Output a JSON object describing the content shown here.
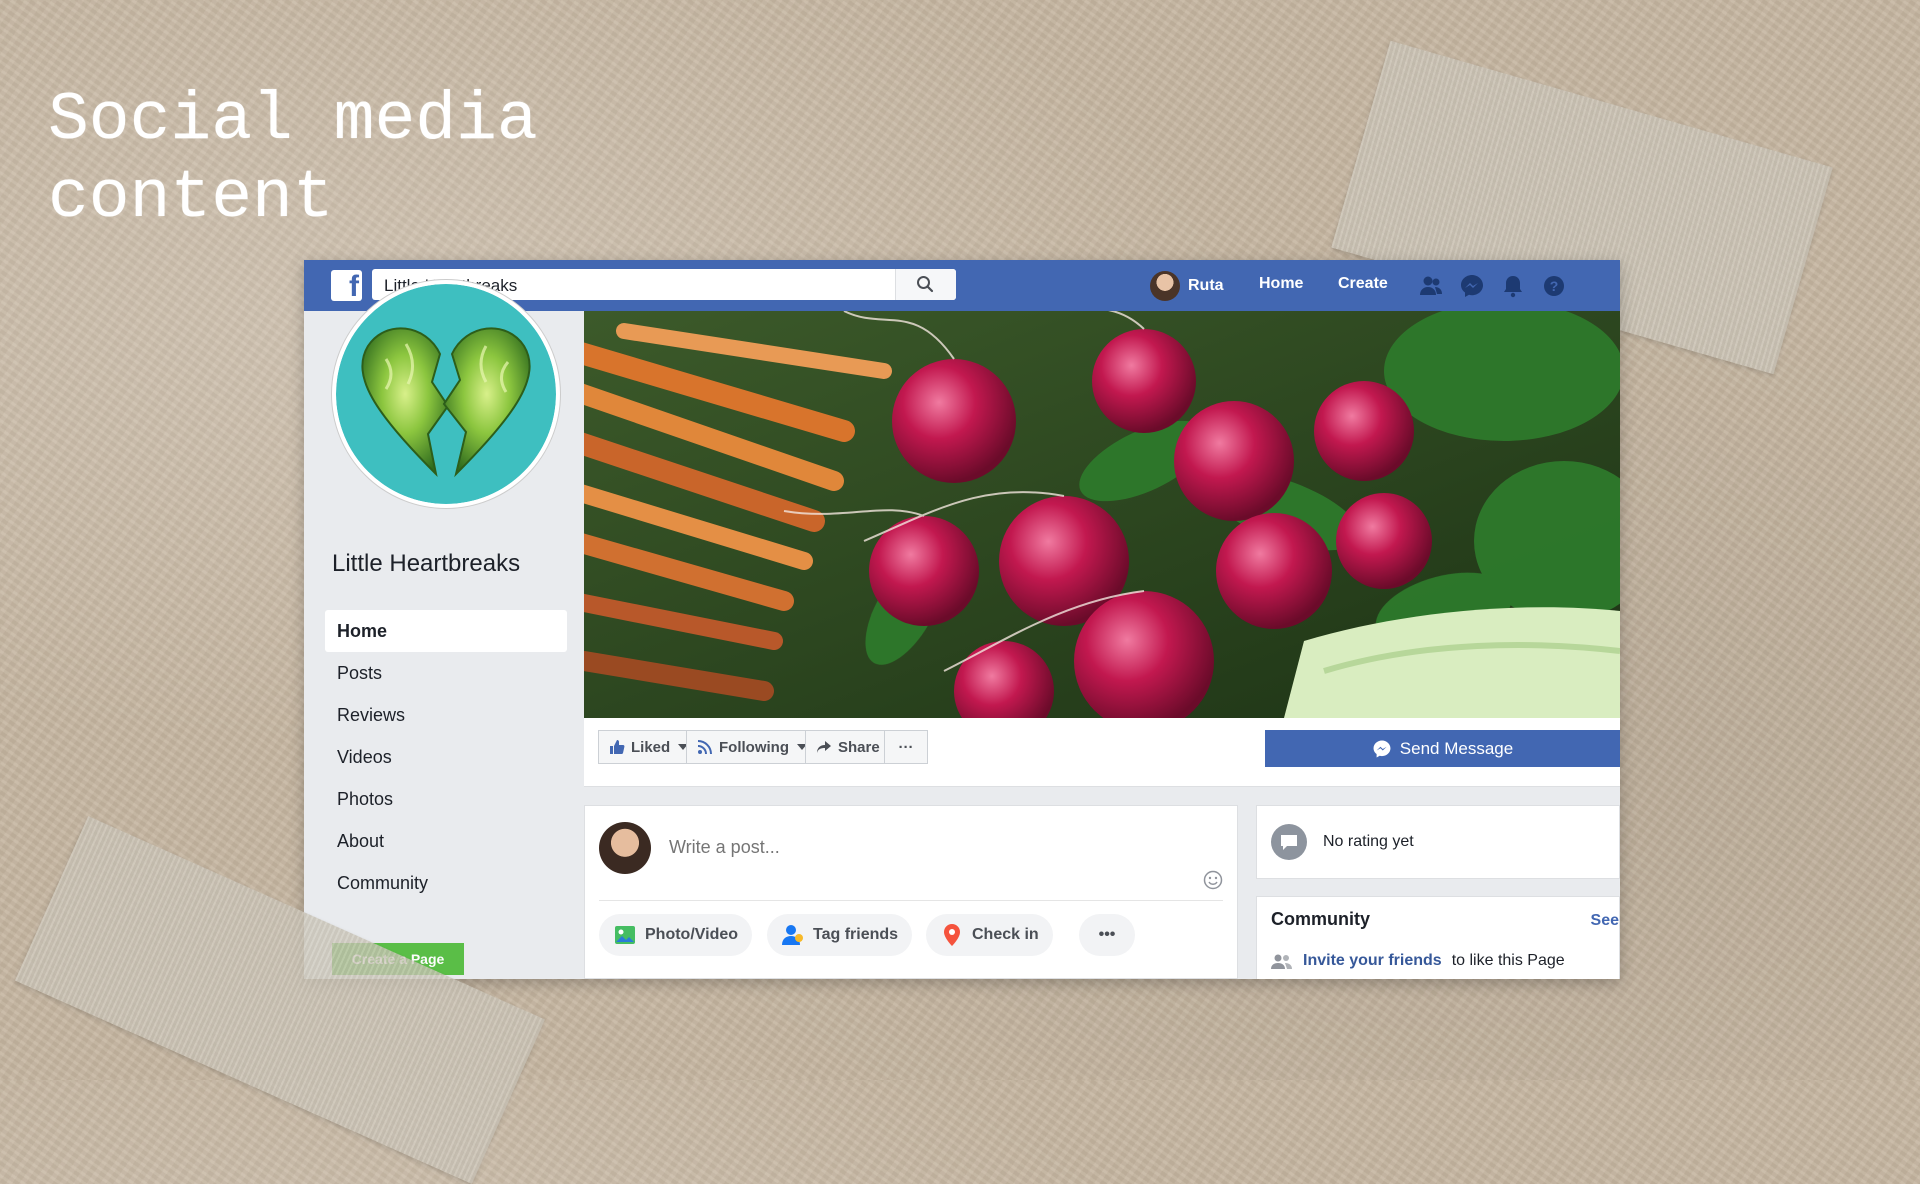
{
  "slide": {
    "title": "Social media\ncontent"
  },
  "topbar": {
    "search_value": "Little Heartbreaks",
    "user_name": "Ruta",
    "nav_home": "Home",
    "nav_create": "Create"
  },
  "page": {
    "name": "Little Heartbreaks"
  },
  "sidebar": {
    "items": [
      {
        "label": "Home",
        "active": true
      },
      {
        "label": "Posts"
      },
      {
        "label": "Reviews"
      },
      {
        "label": "Videos"
      },
      {
        "label": "Photos"
      },
      {
        "label": "About"
      },
      {
        "label": "Community"
      }
    ],
    "create_page": "Create a Page"
  },
  "actions": {
    "liked": "Liked",
    "following": "Following",
    "share": "Share",
    "more": "···",
    "send_message": "Send Message"
  },
  "composer": {
    "placeholder": "Write a post...",
    "photo_video": "Photo/Video",
    "tag_friends": "Tag friends",
    "check_in": "Check in",
    "more": "•••"
  },
  "rating": {
    "text": "No rating yet"
  },
  "community": {
    "title": "Community",
    "see_all": "See",
    "invite_link": "Invite your friends",
    "invite_rest": "to like this Page"
  },
  "colors": {
    "facebook_blue": "#4267b2",
    "teal": "#3ebfc0",
    "green": "#42b72a"
  }
}
